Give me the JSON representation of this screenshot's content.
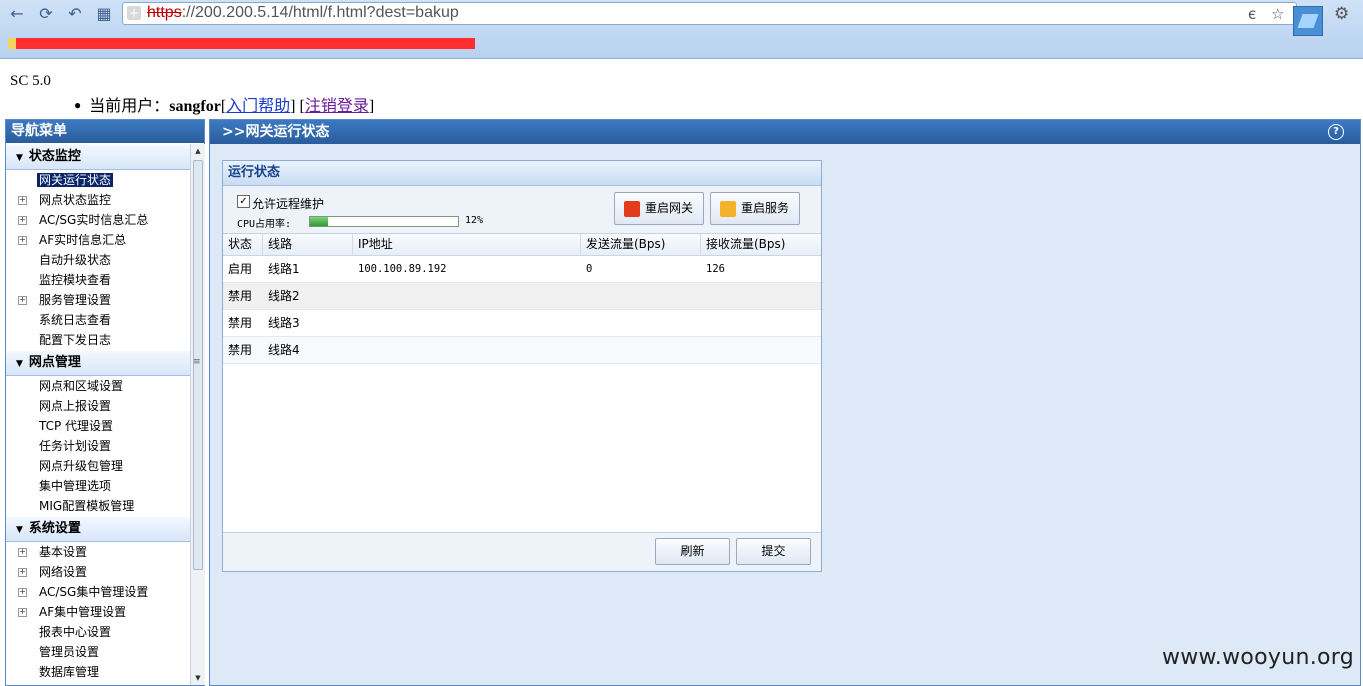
{
  "browser": {
    "url_protocol": "https",
    "url_rest": "://200.200.5.14/html/f.html?dest=bakup",
    "icons": [
      "back-icon",
      "forward-icon",
      "reload-icon",
      "home-icon",
      "ie-icon",
      "star-icon",
      "extension-icon",
      "wrench-icon"
    ]
  },
  "page": {
    "version": "SC 5.0",
    "user_prefix": "当前用户：",
    "username": "sangfor",
    "help_link": "入门帮助",
    "logout_link": "注销登录",
    "watermark": "www.wooyun.org"
  },
  "nav": {
    "title": "导航菜单",
    "sections": [
      {
        "label": "状态监控",
        "items": [
          {
            "label": "网关运行状态",
            "expandable": false,
            "active": true
          },
          {
            "label": "网点状态监控",
            "expandable": true
          },
          {
            "label": "AC/SG实时信息汇总",
            "expandable": true
          },
          {
            "label": "AF实时信息汇总",
            "expandable": true
          },
          {
            "label": "自动升级状态",
            "expandable": false
          },
          {
            "label": "监控模块查看",
            "expandable": false
          },
          {
            "label": "服务管理设置",
            "expandable": true
          },
          {
            "label": "系统日志查看",
            "expandable": false
          },
          {
            "label": "配置下发日志",
            "expandable": false
          }
        ]
      },
      {
        "label": "网点管理",
        "items": [
          {
            "label": "网点和区域设置",
            "expandable": false
          },
          {
            "label": "网点上报设置",
            "expandable": false
          },
          {
            "label": "TCP 代理设置",
            "expandable": false
          },
          {
            "label": "任务计划设置",
            "expandable": false
          },
          {
            "label": "网点升级包管理",
            "expandable": false
          },
          {
            "label": "集中管理选项",
            "expandable": false
          },
          {
            "label": "MIG配置模板管理",
            "expandable": false
          }
        ]
      },
      {
        "label": "系统设置",
        "items": [
          {
            "label": "基本设置",
            "expandable": true
          },
          {
            "label": "网络设置",
            "expandable": true
          },
          {
            "label": "AC/SG集中管理设置",
            "expandable": true
          },
          {
            "label": "AF集中管理设置",
            "expandable": true
          },
          {
            "label": "报表中心设置",
            "expandable": false
          },
          {
            "label": "管理员设置",
            "expandable": false
          },
          {
            "label": "数据库管理",
            "expandable": false
          }
        ]
      }
    ]
  },
  "main": {
    "title": ">>网关运行状态",
    "card_title": "运行状态",
    "allow_remote_label": "允许远程维护",
    "allow_remote_checked": true,
    "cpu_label": "CPU占用率:",
    "cpu_percent": 12,
    "cpu_value_text": "12%",
    "restart_gateway_label": "重启网关",
    "restart_service_label": "重启服务",
    "columns": [
      "状态",
      "线路",
      "IP地址",
      "发送流量(Bps)",
      "接收流量(Bps)"
    ],
    "rows": [
      [
        "启用",
        "线路1",
        "100.100.89.192",
        "0",
        "126"
      ],
      [
        "禁用",
        "线路2",
        "",
        "",
        ""
      ],
      [
        "禁用",
        "线路3",
        "",
        "",
        ""
      ],
      [
        "禁用",
        "线路4",
        "",
        "",
        ""
      ]
    ],
    "refresh_label": "刷新",
    "submit_label": "提交"
  }
}
